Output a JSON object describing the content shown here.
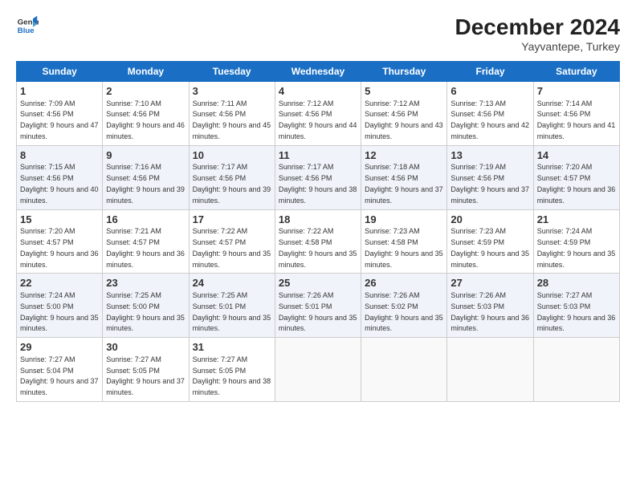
{
  "header": {
    "logo_line1": "General",
    "logo_line2": "Blue",
    "title": "December 2024",
    "subtitle": "Yayvantepe, Turkey"
  },
  "days_of_week": [
    "Sunday",
    "Monday",
    "Tuesday",
    "Wednesday",
    "Thursday",
    "Friday",
    "Saturday"
  ],
  "weeks": [
    [
      {
        "day": "1",
        "rise": "7:09 AM",
        "set": "4:56 PM",
        "daylight": "9 hours and 47 minutes."
      },
      {
        "day": "2",
        "rise": "7:10 AM",
        "set": "4:56 PM",
        "daylight": "9 hours and 46 minutes."
      },
      {
        "day": "3",
        "rise": "7:11 AM",
        "set": "4:56 PM",
        "daylight": "9 hours and 45 minutes."
      },
      {
        "day": "4",
        "rise": "7:12 AM",
        "set": "4:56 PM",
        "daylight": "9 hours and 44 minutes."
      },
      {
        "day": "5",
        "rise": "7:12 AM",
        "set": "4:56 PM",
        "daylight": "9 hours and 43 minutes."
      },
      {
        "day": "6",
        "rise": "7:13 AM",
        "set": "4:56 PM",
        "daylight": "9 hours and 42 minutes."
      },
      {
        "day": "7",
        "rise": "7:14 AM",
        "set": "4:56 PM",
        "daylight": "9 hours and 41 minutes."
      }
    ],
    [
      {
        "day": "8",
        "rise": "7:15 AM",
        "set": "4:56 PM",
        "daylight": "9 hours and 40 minutes."
      },
      {
        "day": "9",
        "rise": "7:16 AM",
        "set": "4:56 PM",
        "daylight": "9 hours and 39 minutes."
      },
      {
        "day": "10",
        "rise": "7:17 AM",
        "set": "4:56 PM",
        "daylight": "9 hours and 39 minutes."
      },
      {
        "day": "11",
        "rise": "7:17 AM",
        "set": "4:56 PM",
        "daylight": "9 hours and 38 minutes."
      },
      {
        "day": "12",
        "rise": "7:18 AM",
        "set": "4:56 PM",
        "daylight": "9 hours and 37 minutes."
      },
      {
        "day": "13",
        "rise": "7:19 AM",
        "set": "4:56 PM",
        "daylight": "9 hours and 37 minutes."
      },
      {
        "day": "14",
        "rise": "7:20 AM",
        "set": "4:57 PM",
        "daylight": "9 hours and 36 minutes."
      }
    ],
    [
      {
        "day": "15",
        "rise": "7:20 AM",
        "set": "4:57 PM",
        "daylight": "9 hours and 36 minutes."
      },
      {
        "day": "16",
        "rise": "7:21 AM",
        "set": "4:57 PM",
        "daylight": "9 hours and 36 minutes."
      },
      {
        "day": "17",
        "rise": "7:22 AM",
        "set": "4:57 PM",
        "daylight": "9 hours and 35 minutes."
      },
      {
        "day": "18",
        "rise": "7:22 AM",
        "set": "4:58 PM",
        "daylight": "9 hours and 35 minutes."
      },
      {
        "day": "19",
        "rise": "7:23 AM",
        "set": "4:58 PM",
        "daylight": "9 hours and 35 minutes."
      },
      {
        "day": "20",
        "rise": "7:23 AM",
        "set": "4:59 PM",
        "daylight": "9 hours and 35 minutes."
      },
      {
        "day": "21",
        "rise": "7:24 AM",
        "set": "4:59 PM",
        "daylight": "9 hours and 35 minutes."
      }
    ],
    [
      {
        "day": "22",
        "rise": "7:24 AM",
        "set": "5:00 PM",
        "daylight": "9 hours and 35 minutes."
      },
      {
        "day": "23",
        "rise": "7:25 AM",
        "set": "5:00 PM",
        "daylight": "9 hours and 35 minutes."
      },
      {
        "day": "24",
        "rise": "7:25 AM",
        "set": "5:01 PM",
        "daylight": "9 hours and 35 minutes."
      },
      {
        "day": "25",
        "rise": "7:26 AM",
        "set": "5:01 PM",
        "daylight": "9 hours and 35 minutes."
      },
      {
        "day": "26",
        "rise": "7:26 AM",
        "set": "5:02 PM",
        "daylight": "9 hours and 35 minutes."
      },
      {
        "day": "27",
        "rise": "7:26 AM",
        "set": "5:03 PM",
        "daylight": "9 hours and 36 minutes."
      },
      {
        "day": "28",
        "rise": "7:27 AM",
        "set": "5:03 PM",
        "daylight": "9 hours and 36 minutes."
      }
    ],
    [
      {
        "day": "29",
        "rise": "7:27 AM",
        "set": "5:04 PM",
        "daylight": "9 hours and 37 minutes."
      },
      {
        "day": "30",
        "rise": "7:27 AM",
        "set": "5:05 PM",
        "daylight": "9 hours and 37 minutes."
      },
      {
        "day": "31",
        "rise": "7:27 AM",
        "set": "5:05 PM",
        "daylight": "9 hours and 38 minutes."
      },
      null,
      null,
      null,
      null
    ]
  ]
}
